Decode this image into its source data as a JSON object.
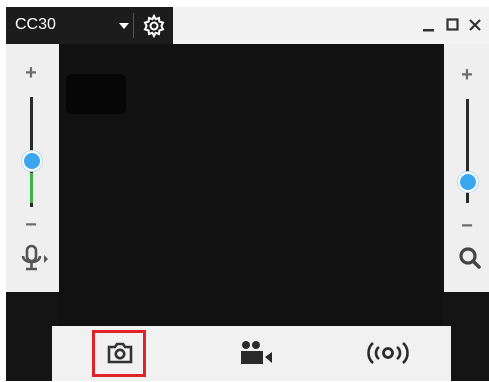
{
  "titlebar": {
    "device_name": "CC30",
    "device_select_icon": "chevron-down-icon",
    "settings_icon": "gear-icon",
    "minimize_icon": "minimize-icon",
    "maximize_icon": "maximize-icon",
    "close_icon": "close-icon"
  },
  "left_panel": {
    "increase_symbol": "+",
    "decrease_symbol": "−",
    "volume_level": 0.42,
    "mic_icon": "microphone-icon"
  },
  "right_panel": {
    "increase_symbol": "+",
    "decrease_symbol": "−",
    "zoom_level": 0.2,
    "zoom_icon": "magnifier-icon"
  },
  "toolbar": {
    "snapshot_icon": "camera-icon",
    "record_icon": "video-camera-icon",
    "stream_icon": "broadcast-icon",
    "highlight_color": "#e0222c"
  },
  "colors": {
    "accent": "#39a6ee",
    "level_green": "#3db34a",
    "preview_bg": "#111111"
  }
}
